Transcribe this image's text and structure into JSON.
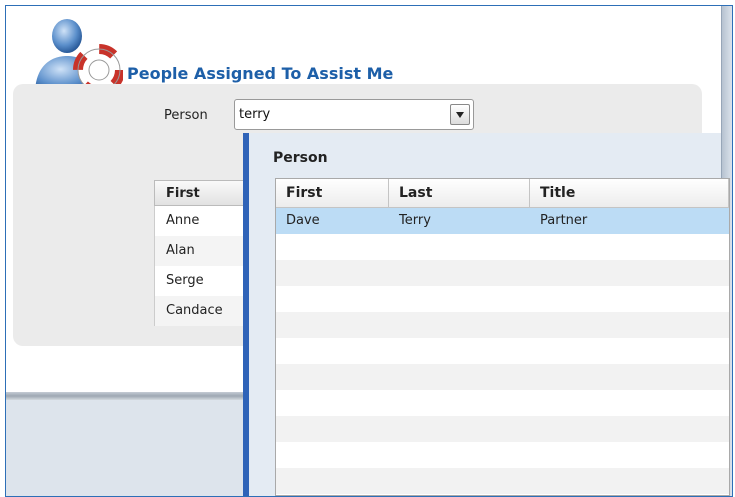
{
  "header": {
    "title": "People Assigned To Assist Me",
    "icon": "assistance-person-lifebuoy-icon"
  },
  "form": {
    "person_label": "Person",
    "person_value": "terry"
  },
  "background_table": {
    "header": "First",
    "rows": [
      "Anne",
      "Alan",
      "Serge",
      "Candace"
    ]
  },
  "popup": {
    "title": "Person",
    "columns": [
      "First",
      "Last",
      "Title"
    ],
    "rows": [
      {
        "first": "Dave",
        "last": "Terry",
        "title": "Partner",
        "selected": true
      }
    ]
  },
  "colors": {
    "accent": "#1d5fa8",
    "selection": "#bcdcf5",
    "popup_border": "#2f63b8"
  }
}
